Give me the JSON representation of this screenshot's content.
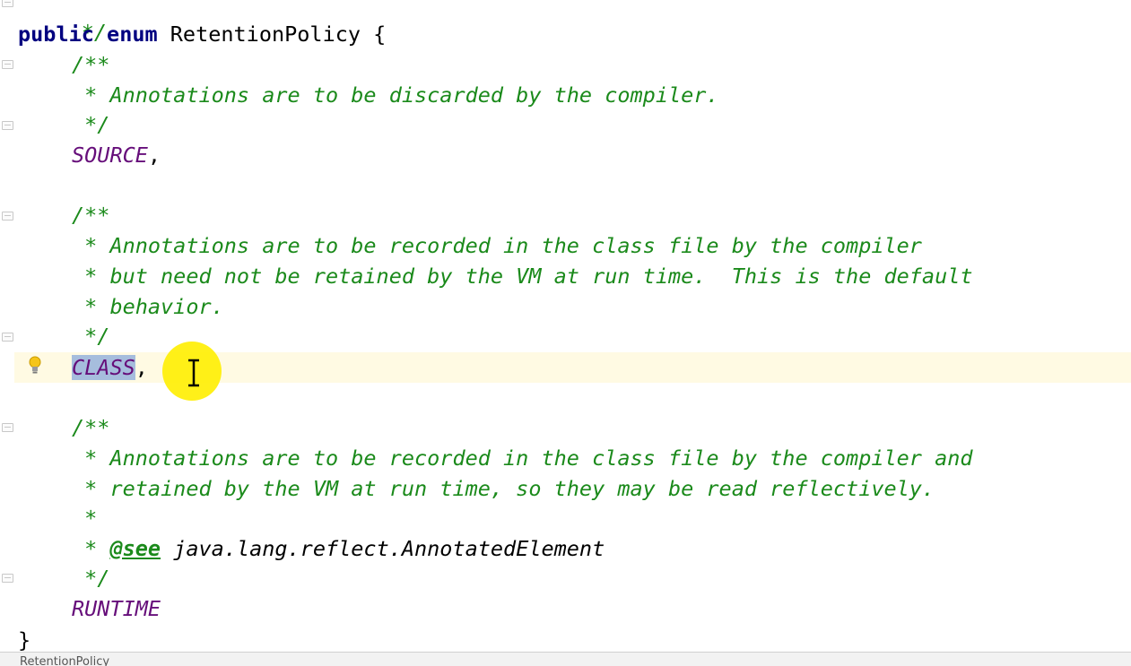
{
  "editor": {
    "line_top_comment_end": " */",
    "kw_public": "public",
    "kw_enum": "enum",
    "enum_name": " RetentionPolicy {",
    "source": {
      "open": "/**",
      "body": " * Annotations are to be discarded by the compiler.",
      "close": " */",
      "constant": "SOURCE",
      "comma": ","
    },
    "class": {
      "open": "/**",
      "body1": " * Annotations are to be recorded in the class file by the compiler",
      "body2": " * but need not be retained by the VM at run time.  This is the default",
      "body3": " * behavior.",
      "close": " */",
      "constant": "CLASS",
      "comma": ","
    },
    "runtime": {
      "open": "/**",
      "body1": " * Annotations are to be recorded in the class file by the compiler and",
      "body2": " * retained by the VM at run time, so they may be read reflectively.",
      "blank": " *",
      "see_prefix": " * ",
      "see_tag": "@see",
      "see_ref": " java.lang.reflect.AnnotatedElement",
      "close": " */",
      "constant": "RUNTIME"
    },
    "closing_brace": "}"
  },
  "statusbar": {
    "breadcrumb": "RetentionPolicy"
  },
  "colors": {
    "keyword": "#000080",
    "comment": "#1b8a1b",
    "constant": "#660e7a",
    "selection": "#a6bddd",
    "caret_row": "#fffae3",
    "cursor_highlight": "#ffee00"
  },
  "icons": [
    "intention-bulb-icon",
    "fold-marker-icon",
    "text-cursor-icon"
  ]
}
